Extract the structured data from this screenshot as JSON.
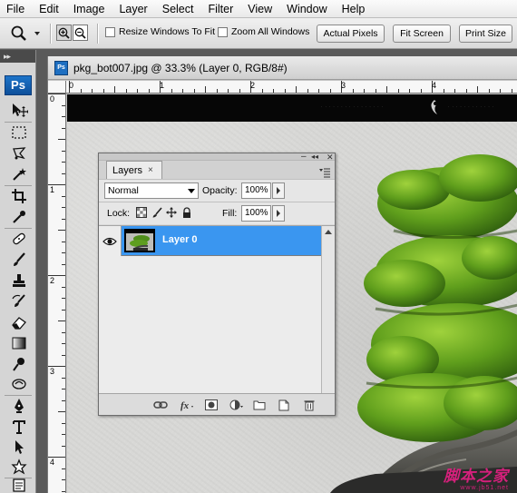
{
  "menubar": {
    "items": [
      "File",
      "Edit",
      "Image",
      "Layer",
      "Select",
      "Filter",
      "View",
      "Window",
      "Help"
    ]
  },
  "options": {
    "resize_windows_label": "Resize Windows To Fit",
    "zoom_all_label": "Zoom All Windows",
    "actual_pixels_label": "Actual Pixels",
    "fit_screen_label": "Fit Screen",
    "print_size_label": "Print Size"
  },
  "toolbox": {
    "grip": "▸▸",
    "logo": "Ps"
  },
  "document": {
    "icon_text": "Ps",
    "title": "pkg_bot007.jpg @ 33.3% (Layer 0, RGB/8#)",
    "ruler_h_labels": [
      "0",
      "1",
      "2",
      "3",
      "4"
    ],
    "ruler_v_labels": [
      "0",
      "1",
      "2",
      "3",
      "4"
    ],
    "watermark_main": "脚本之家",
    "watermark_sub": "www.jb51.net"
  },
  "layers_panel": {
    "collapse_glyph": "◂◂",
    "close_glyph": "✕",
    "minimize_glyph": "–",
    "tab_label": "Layers",
    "tab_close": "×",
    "blend_mode": "Normal",
    "opacity_label": "Opacity:",
    "opacity_value": "100%",
    "lock_label": "Lock:",
    "fill_label": "Fill:",
    "fill_value": "100%",
    "layers": [
      {
        "name": "Layer 0",
        "visible": true,
        "selected": true
      }
    ]
  },
  "colors": {
    "accent": "#3a96f0",
    "ps_blue": "#1d74c9",
    "watermark": "#d6207c"
  }
}
